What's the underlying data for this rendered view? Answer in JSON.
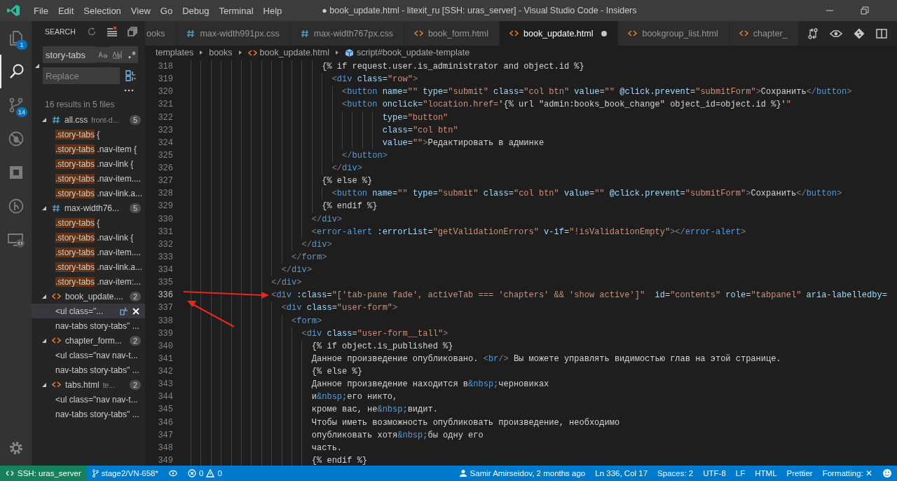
{
  "window": {
    "title": "● book_update.html - litexit_ru [SSH: uras_server] - Visual Studio Code - Insiders"
  },
  "menu": [
    "File",
    "Edit",
    "Selection",
    "View",
    "Go",
    "Debug",
    "Terminal",
    "Help"
  ],
  "activity_bar": [
    {
      "kind": "files",
      "badge": "1",
      "selected": false
    },
    {
      "kind": "search",
      "selected": true
    },
    {
      "kind": "git",
      "badge": "14",
      "selected": false
    },
    {
      "kind": "debug",
      "selected": false
    },
    {
      "kind": "extensions",
      "selected": false
    },
    {
      "kind": "gitlens",
      "selected": false
    },
    {
      "kind": "remote",
      "selected": false
    }
  ],
  "sidebar": {
    "title": "SEARCH",
    "search_value": "story-tabs",
    "replace_placeholder": "Replace",
    "summary": "16 results in 5 files",
    "files": [
      {
        "kind": "css",
        "name": "all.css",
        "path": "front-d...",
        "count": "5",
        "results": [
          {
            "match": ".story-tabs",
            "text": " {",
            "selected": false
          },
          {
            "match": ".story-tabs",
            "text": " .nav-item {",
            "selected": false
          },
          {
            "match": ".story-tabs",
            "text": " .nav-link {",
            "selected": false
          },
          {
            "match": ".story-tabs",
            "text": " .nav-item....",
            "selected": false
          },
          {
            "match": ".story-tabs",
            "text": " .nav-link.a...",
            "selected": false
          }
        ]
      },
      {
        "kind": "css",
        "name": "max-width76...",
        "count": "5",
        "results": [
          {
            "match": ".story-tabs",
            "text": " {",
            "selected": false
          },
          {
            "match": ".story-tabs",
            "text": " .nav-link {",
            "selected": false
          },
          {
            "match": ".story-tabs",
            "text": " .nav-item....",
            "selected": false
          },
          {
            "match": ".story-tabs",
            "text": " .nav-link.a...",
            "selected": false
          },
          {
            "match": ".story-tabs",
            "text": " .nav-item:...",
            "selected": false
          }
        ]
      },
      {
        "kind": "html",
        "name": "book_update....",
        "count": "2",
        "results": [
          {
            "text": "<ul class=\"...",
            "selected": true
          },
          {
            "text": "nav-tabs story-tabs\" ...",
            "selected": false
          }
        ]
      },
      {
        "kind": "html",
        "name": "chapter_form...",
        "count": "2",
        "results": [
          {
            "text": "<ul class=\"nav nav-t...",
            "selected": false
          },
          {
            "text": "nav-tabs story-tabs\" ...",
            "selected": false
          }
        ]
      },
      {
        "kind": "html",
        "name": "tabs.html",
        "path": "te...",
        "count": "2",
        "results": [
          {
            "text": "<ul class=\"nav nav-t...",
            "selected": false
          },
          {
            "text": "nav-tabs story-tabs\" ...",
            "selected": false
          }
        ]
      }
    ]
  },
  "tabs": [
    {
      "kind": "partial",
      "label": "ooks",
      "selected": false,
      "dirty": false
    },
    {
      "kind": "css",
      "label": "max-width991px.css",
      "selected": false,
      "dirty": false
    },
    {
      "kind": "css",
      "label": "max-width767px.css",
      "selected": false,
      "dirty": false
    },
    {
      "kind": "html",
      "label": "book_form.html",
      "selected": false,
      "dirty": false
    },
    {
      "kind": "html",
      "label": "book_update.html",
      "selected": true,
      "dirty": true
    },
    {
      "kind": "html",
      "label": "bookgroup_list.html",
      "selected": false,
      "dirty": false
    },
    {
      "kind": "html",
      "label": "chapter_",
      "selected": false,
      "dirty": false
    }
  ],
  "breadcrumbs": [
    {
      "kind": "folder",
      "label": "templates"
    },
    {
      "kind": "folder",
      "label": "books"
    },
    {
      "kind": "html",
      "label": "book_update.html"
    },
    {
      "kind": "symbol",
      "label": "script#book_update-template"
    }
  ],
  "editor": {
    "lines": [
      {
        "number": "318",
        "current": false,
        "tokens": [
          {
            "kind": "text",
            "text": "                          {% if request.user.is_administrator and object.id %}"
          }
        ]
      },
      {
        "number": "319",
        "current": false,
        "tokens": [
          {
            "kind": "punct",
            "text": "                            <"
          },
          {
            "kind": "tag",
            "text": "div"
          },
          {
            "kind": "attr",
            "text": " class"
          },
          {
            "kind": "text",
            "text": "="
          },
          {
            "kind": "string",
            "text": "\"row\""
          },
          {
            "kind": "punct",
            "text": ">"
          }
        ]
      },
      {
        "number": "320",
        "current": false,
        "tokens": [
          {
            "kind": "punct",
            "text": "                              <"
          },
          {
            "kind": "tag",
            "text": "button"
          },
          {
            "kind": "attr",
            "text": " name"
          },
          {
            "kind": "text",
            "text": "="
          },
          {
            "kind": "string",
            "text": "\"\""
          },
          {
            "kind": "attr",
            "text": " type"
          },
          {
            "kind": "text",
            "text": "="
          },
          {
            "kind": "string",
            "text": "\"submit\""
          },
          {
            "kind": "attr",
            "text": " class"
          },
          {
            "kind": "text",
            "text": "="
          },
          {
            "kind": "string",
            "text": "\"col btn\""
          },
          {
            "kind": "attr",
            "text": " value"
          },
          {
            "kind": "text",
            "text": "="
          },
          {
            "kind": "string",
            "text": "\"\""
          },
          {
            "kind": "attr",
            "text": " @click.prevent"
          },
          {
            "kind": "text",
            "text": "="
          },
          {
            "kind": "string",
            "text": "\"submitForm\""
          },
          {
            "kind": "punct",
            "text": ">"
          },
          {
            "kind": "text",
            "text": "Сохранить"
          },
          {
            "kind": "punct",
            "text": "</"
          },
          {
            "kind": "tag",
            "text": "button"
          },
          {
            "kind": "punct",
            "text": ">"
          }
        ]
      },
      {
        "number": "321",
        "current": false,
        "tokens": [
          {
            "kind": "punct",
            "text": "                              <"
          },
          {
            "kind": "tag",
            "text": "button"
          },
          {
            "kind": "attr",
            "text": " onclick"
          },
          {
            "kind": "text",
            "text": "="
          },
          {
            "kind": "string",
            "text": "\"location.href="
          },
          {
            "kind": "text",
            "text": "'{% url \"admin:books_book_change\" object_id=object.id %}'"
          },
          {
            "kind": "string",
            "text": "\""
          }
        ]
      },
      {
        "number": "322",
        "current": false,
        "tokens": [
          {
            "kind": "attr",
            "text": "                                      type"
          },
          {
            "kind": "text",
            "text": "="
          },
          {
            "kind": "string",
            "text": "\"button\""
          }
        ]
      },
      {
        "number": "323",
        "current": false,
        "tokens": [
          {
            "kind": "attr",
            "text": "                                      class"
          },
          {
            "kind": "text",
            "text": "="
          },
          {
            "kind": "string",
            "text": "\"col btn\""
          }
        ]
      },
      {
        "number": "324",
        "current": false,
        "tokens": [
          {
            "kind": "attr",
            "text": "                                      value"
          },
          {
            "kind": "text",
            "text": "="
          },
          {
            "kind": "string",
            "text": "\"\""
          },
          {
            "kind": "punct",
            "text": ">"
          },
          {
            "kind": "text",
            "text": "Редактировать в админке"
          }
        ]
      },
      {
        "number": "325",
        "current": false,
        "tokens": [
          {
            "kind": "punct",
            "text": "                              </"
          },
          {
            "kind": "tag",
            "text": "button"
          },
          {
            "kind": "punct",
            "text": ">"
          }
        ]
      },
      {
        "number": "326",
        "current": false,
        "tokens": [
          {
            "kind": "punct",
            "text": "                            </"
          },
          {
            "kind": "tag",
            "text": "div"
          },
          {
            "kind": "punct",
            "text": ">"
          }
        ]
      },
      {
        "number": "327",
        "current": false,
        "tokens": [
          {
            "kind": "text",
            "text": "                          {% else %}"
          }
        ]
      },
      {
        "number": "328",
        "current": false,
        "tokens": [
          {
            "kind": "punct",
            "text": "                            <"
          },
          {
            "kind": "tag",
            "text": "button"
          },
          {
            "kind": "attr",
            "text": " name"
          },
          {
            "kind": "text",
            "text": "="
          },
          {
            "kind": "string",
            "text": "\"\""
          },
          {
            "kind": "attr",
            "text": " type"
          },
          {
            "kind": "text",
            "text": "="
          },
          {
            "kind": "string",
            "text": "\"submit\""
          },
          {
            "kind": "attr",
            "text": " class"
          },
          {
            "kind": "text",
            "text": "="
          },
          {
            "kind": "string",
            "text": "\"col btn\""
          },
          {
            "kind": "attr",
            "text": " value"
          },
          {
            "kind": "text",
            "text": "="
          },
          {
            "kind": "string",
            "text": "\"\""
          },
          {
            "kind": "attr",
            "text": " @click.prevent"
          },
          {
            "kind": "text",
            "text": "="
          },
          {
            "kind": "string",
            "text": "\"submitForm\""
          },
          {
            "kind": "punct",
            "text": ">"
          },
          {
            "kind": "text",
            "text": "Сохранить"
          },
          {
            "kind": "punct",
            "text": "</"
          },
          {
            "kind": "tag",
            "text": "button"
          },
          {
            "kind": "punct",
            "text": ">"
          }
        ]
      },
      {
        "number": "329",
        "current": false,
        "tokens": [
          {
            "kind": "text",
            "text": "                          {% endif %}"
          }
        ]
      },
      {
        "number": "330",
        "current": false,
        "tokens": [
          {
            "kind": "punct",
            "text": "                        </"
          },
          {
            "kind": "tag",
            "text": "div"
          },
          {
            "kind": "punct",
            "text": ">"
          }
        ]
      },
      {
        "number": "331",
        "current": false,
        "tokens": [
          {
            "kind": "punct",
            "text": "                        <"
          },
          {
            "kind": "tag",
            "text": "error-alert"
          },
          {
            "kind": "attr",
            "text": " :errorList"
          },
          {
            "kind": "text",
            "text": "="
          },
          {
            "kind": "string",
            "text": "\"getValidationErrors\""
          },
          {
            "kind": "attr",
            "text": " v-if"
          },
          {
            "kind": "text",
            "text": "="
          },
          {
            "kind": "string",
            "text": "\"!isValidationEmpty\""
          },
          {
            "kind": "punct",
            "text": "></"
          },
          {
            "kind": "tag",
            "text": "error-alert"
          },
          {
            "kind": "punct",
            "text": ">"
          }
        ]
      },
      {
        "number": "332",
        "current": false,
        "tokens": [
          {
            "kind": "punct",
            "text": "                      </"
          },
          {
            "kind": "tag",
            "text": "div"
          },
          {
            "kind": "punct",
            "text": ">"
          }
        ]
      },
      {
        "number": "333",
        "current": false,
        "tokens": [
          {
            "kind": "punct",
            "text": "                    </"
          },
          {
            "kind": "tag",
            "text": "form"
          },
          {
            "kind": "punct",
            "text": ">"
          }
        ]
      },
      {
        "number": "334",
        "current": false,
        "tokens": [
          {
            "kind": "punct",
            "text": "                  </"
          },
          {
            "kind": "tag",
            "text": "div"
          },
          {
            "kind": "punct",
            "text": ">"
          }
        ]
      },
      {
        "number": "335",
        "current": false,
        "tokens": [
          {
            "kind": "punct",
            "text": "                </"
          },
          {
            "kind": "tag",
            "text": "div"
          },
          {
            "kind": "punct",
            "text": ">"
          }
        ]
      },
      {
        "number": "336",
        "current": true,
        "tokens": [
          {
            "kind": "punct",
            "text": "                <"
          },
          {
            "kind": "tag",
            "text": "div"
          },
          {
            "kind": "attr",
            "text": " :class"
          },
          {
            "kind": "text",
            "text": "="
          },
          {
            "kind": "string",
            "text": "\"['tab-pane fade', activeTab === 'chapters' && 'show active']\""
          },
          {
            "kind": "attr",
            "text": "  id"
          },
          {
            "kind": "text",
            "text": "="
          },
          {
            "kind": "string",
            "text": "\"contents\""
          },
          {
            "kind": "attr",
            "text": " role"
          },
          {
            "kind": "text",
            "text": "="
          },
          {
            "kind": "string",
            "text": "\"tabpanel\""
          },
          {
            "kind": "attr",
            "text": " aria-labelledby="
          }
        ]
      },
      {
        "number": "337",
        "current": false,
        "tokens": [
          {
            "kind": "punct",
            "text": "                  <"
          },
          {
            "kind": "tag",
            "text": "div"
          },
          {
            "kind": "attr",
            "text": " class"
          },
          {
            "kind": "text",
            "text": "="
          },
          {
            "kind": "string",
            "text": "\"user-form\""
          },
          {
            "kind": "punct",
            "text": ">"
          }
        ]
      },
      {
        "number": "338",
        "current": false,
        "tokens": [
          {
            "kind": "punct",
            "text": "                    <"
          },
          {
            "kind": "tag",
            "text": "form"
          },
          {
            "kind": "punct",
            "text": ">"
          }
        ]
      },
      {
        "number": "339",
        "current": false,
        "tokens": [
          {
            "kind": "punct",
            "text": "                      <"
          },
          {
            "kind": "tag",
            "text": "div"
          },
          {
            "kind": "attr",
            "text": " class"
          },
          {
            "kind": "text",
            "text": "="
          },
          {
            "kind": "string",
            "text": "\"user-form__tall\""
          },
          {
            "kind": "punct",
            "text": ">"
          }
        ]
      },
      {
        "number": "340",
        "current": false,
        "tokens": [
          {
            "kind": "text",
            "text": "                        {% if object.is_published %}"
          }
        ]
      },
      {
        "number": "341",
        "current": false,
        "tokens": [
          {
            "kind": "text",
            "text": "                        Данное произведение опубликовано. "
          },
          {
            "kind": "punct",
            "text": "<"
          },
          {
            "kind": "tag",
            "text": "br"
          },
          {
            "kind": "punct",
            "text": "/>"
          },
          {
            "kind": "text",
            "text": " Вы можете управлять видимостью глав на этой странице."
          }
        ]
      },
      {
        "number": "342",
        "current": false,
        "tokens": [
          {
            "kind": "text",
            "text": "                        {% else %}"
          }
        ]
      },
      {
        "number": "343",
        "current": false,
        "tokens": [
          {
            "kind": "text",
            "text": "                        Данное произведение находится в"
          },
          {
            "kind": "entity",
            "text": "&nbsp;"
          },
          {
            "kind": "text",
            "text": "черновиках"
          }
        ]
      },
      {
        "number": "344",
        "current": false,
        "tokens": [
          {
            "kind": "text",
            "text": "                        и"
          },
          {
            "kind": "entity",
            "text": "&nbsp;"
          },
          {
            "kind": "text",
            "text": "его никто,"
          }
        ]
      },
      {
        "number": "345",
        "current": false,
        "tokens": [
          {
            "kind": "text",
            "text": "                        кроме вас, не"
          },
          {
            "kind": "entity",
            "text": "&nbsp;"
          },
          {
            "kind": "text",
            "text": "видит."
          }
        ]
      },
      {
        "number": "346",
        "current": false,
        "tokens": [
          {
            "kind": "text",
            "text": "                        Чтобы иметь возможность опубликовать произведение, необходимо"
          }
        ]
      },
      {
        "number": "347",
        "current": false,
        "tokens": [
          {
            "kind": "text",
            "text": "                        опубликовать хотя"
          },
          {
            "kind": "entity",
            "text": "&nbsp;"
          },
          {
            "kind": "text",
            "text": "бы одну его"
          }
        ]
      },
      {
        "number": "348",
        "current": false,
        "tokens": [
          {
            "kind": "text",
            "text": "                        часть."
          }
        ]
      },
      {
        "number": "349",
        "current": false,
        "tokens": [
          {
            "kind": "text",
            "text": "                        {% endif %}"
          }
        ]
      }
    ]
  },
  "status_bar": {
    "remote": "SSH: uras_server",
    "branch": "stage2/VN-658*",
    "errors": "0",
    "warnings": "0",
    "blame": "Samir Amirseidov, 2 months ago",
    "position": "Ln 336, Col 17",
    "indentation": "Spaces: 2",
    "encoding": "UTF-8",
    "eol": "LF",
    "language": "HTML",
    "formatter": "Prettier",
    "formatting": "Formatting: ✕"
  }
}
